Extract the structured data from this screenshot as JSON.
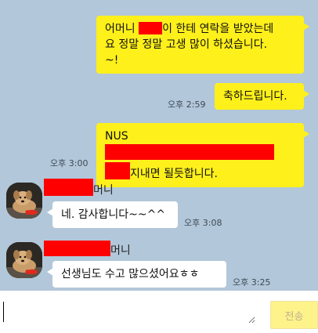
{
  "messages": {
    "m1": {
      "part1": "어머니 ",
      "part2": "이 한테 연락을 받았는데\n요 정말 정말 고생 많이 하셨습니다.\n~!"
    },
    "m2": {
      "text": "축하드립니다.",
      "time": "오후 2:59"
    },
    "m3": {
      "prefix": "NUS ",
      "line2": "지내면 될듯합니다.",
      "time": "오후 3:00"
    },
    "m4": {
      "sender_suffix": "머니",
      "text": "네. 감사합니다~~^^",
      "time": "오후 3:08"
    },
    "m5": {
      "sender_suffix": "머니",
      "text": "선생님도 수고 많으셨어요ㅎㅎ",
      "time": "오후 3:25"
    }
  },
  "composer": {
    "value": "",
    "send_label": "전송"
  },
  "colors": {
    "background": "#b2c7d9",
    "outgoing_bubble": "#fef01b",
    "incoming_bubble": "#ffffff",
    "redaction": "#ff0000",
    "send_button": "#fef28a"
  },
  "icons": {
    "avatar": "dog-photo-avatar"
  }
}
